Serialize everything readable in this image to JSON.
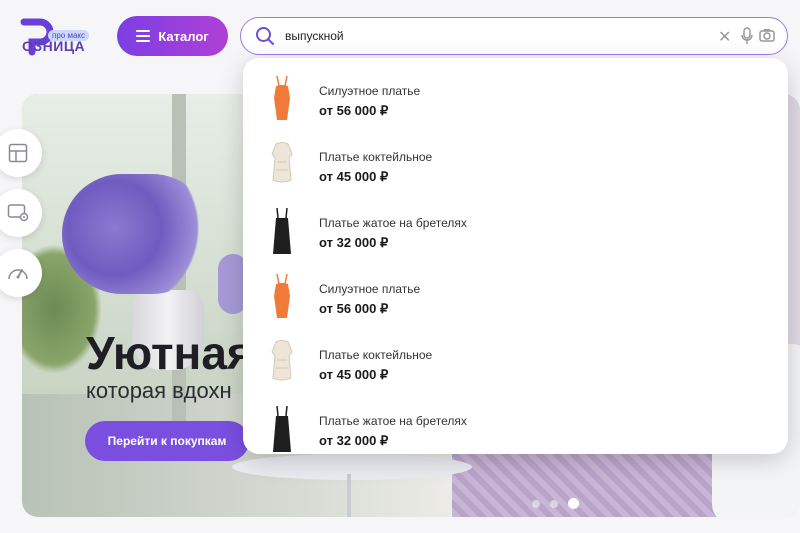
{
  "header": {
    "logo_text": "ОЗНИЦА",
    "logo_badge": "про макс",
    "catalog_label": "Каталог",
    "search": {
      "value": "выпускной",
      "placeholder": ""
    }
  },
  "hero": {
    "title": "Уютная",
    "subtitle": "которая вдохн",
    "cta_label": "Перейти к покупкам",
    "slide_count": 3,
    "active_slide": 3
  },
  "side_buttons": [
    {
      "icon": "layout-icon"
    },
    {
      "icon": "monitor-settings-icon"
    },
    {
      "icon": "speedometer-icon"
    }
  ],
  "suggestions": [
    {
      "name": "Силуэтное платье",
      "price": "от 56 000 ₽",
      "thumb": "orange-dress",
      "color": "#f07a3a"
    },
    {
      "name": "Платье коктейльное",
      "price": "от 45 000 ₽",
      "thumb": "white-dress",
      "color": "#eee5d8"
    },
    {
      "name": "Платье жатое на бретелях",
      "price": "от 32 000 ₽",
      "thumb": "black-dress",
      "color": "#1f1f1f"
    },
    {
      "name": "Силуэтное платье",
      "price": "от 56 000 ₽",
      "thumb": "orange-dress",
      "color": "#f07a3a"
    },
    {
      "name": "Платье коктейльное",
      "price": "от 45 000 ₽",
      "thumb": "white-dress",
      "color": "#eee5d8"
    },
    {
      "name": "Платье жатое на бретелях",
      "price": "от 32 000 ₽",
      "thumb": "black-dress",
      "color": "#1f1f1f"
    }
  ],
  "colors": {
    "accent": "#7a4fe0",
    "search_border": "#9a7ce8"
  }
}
